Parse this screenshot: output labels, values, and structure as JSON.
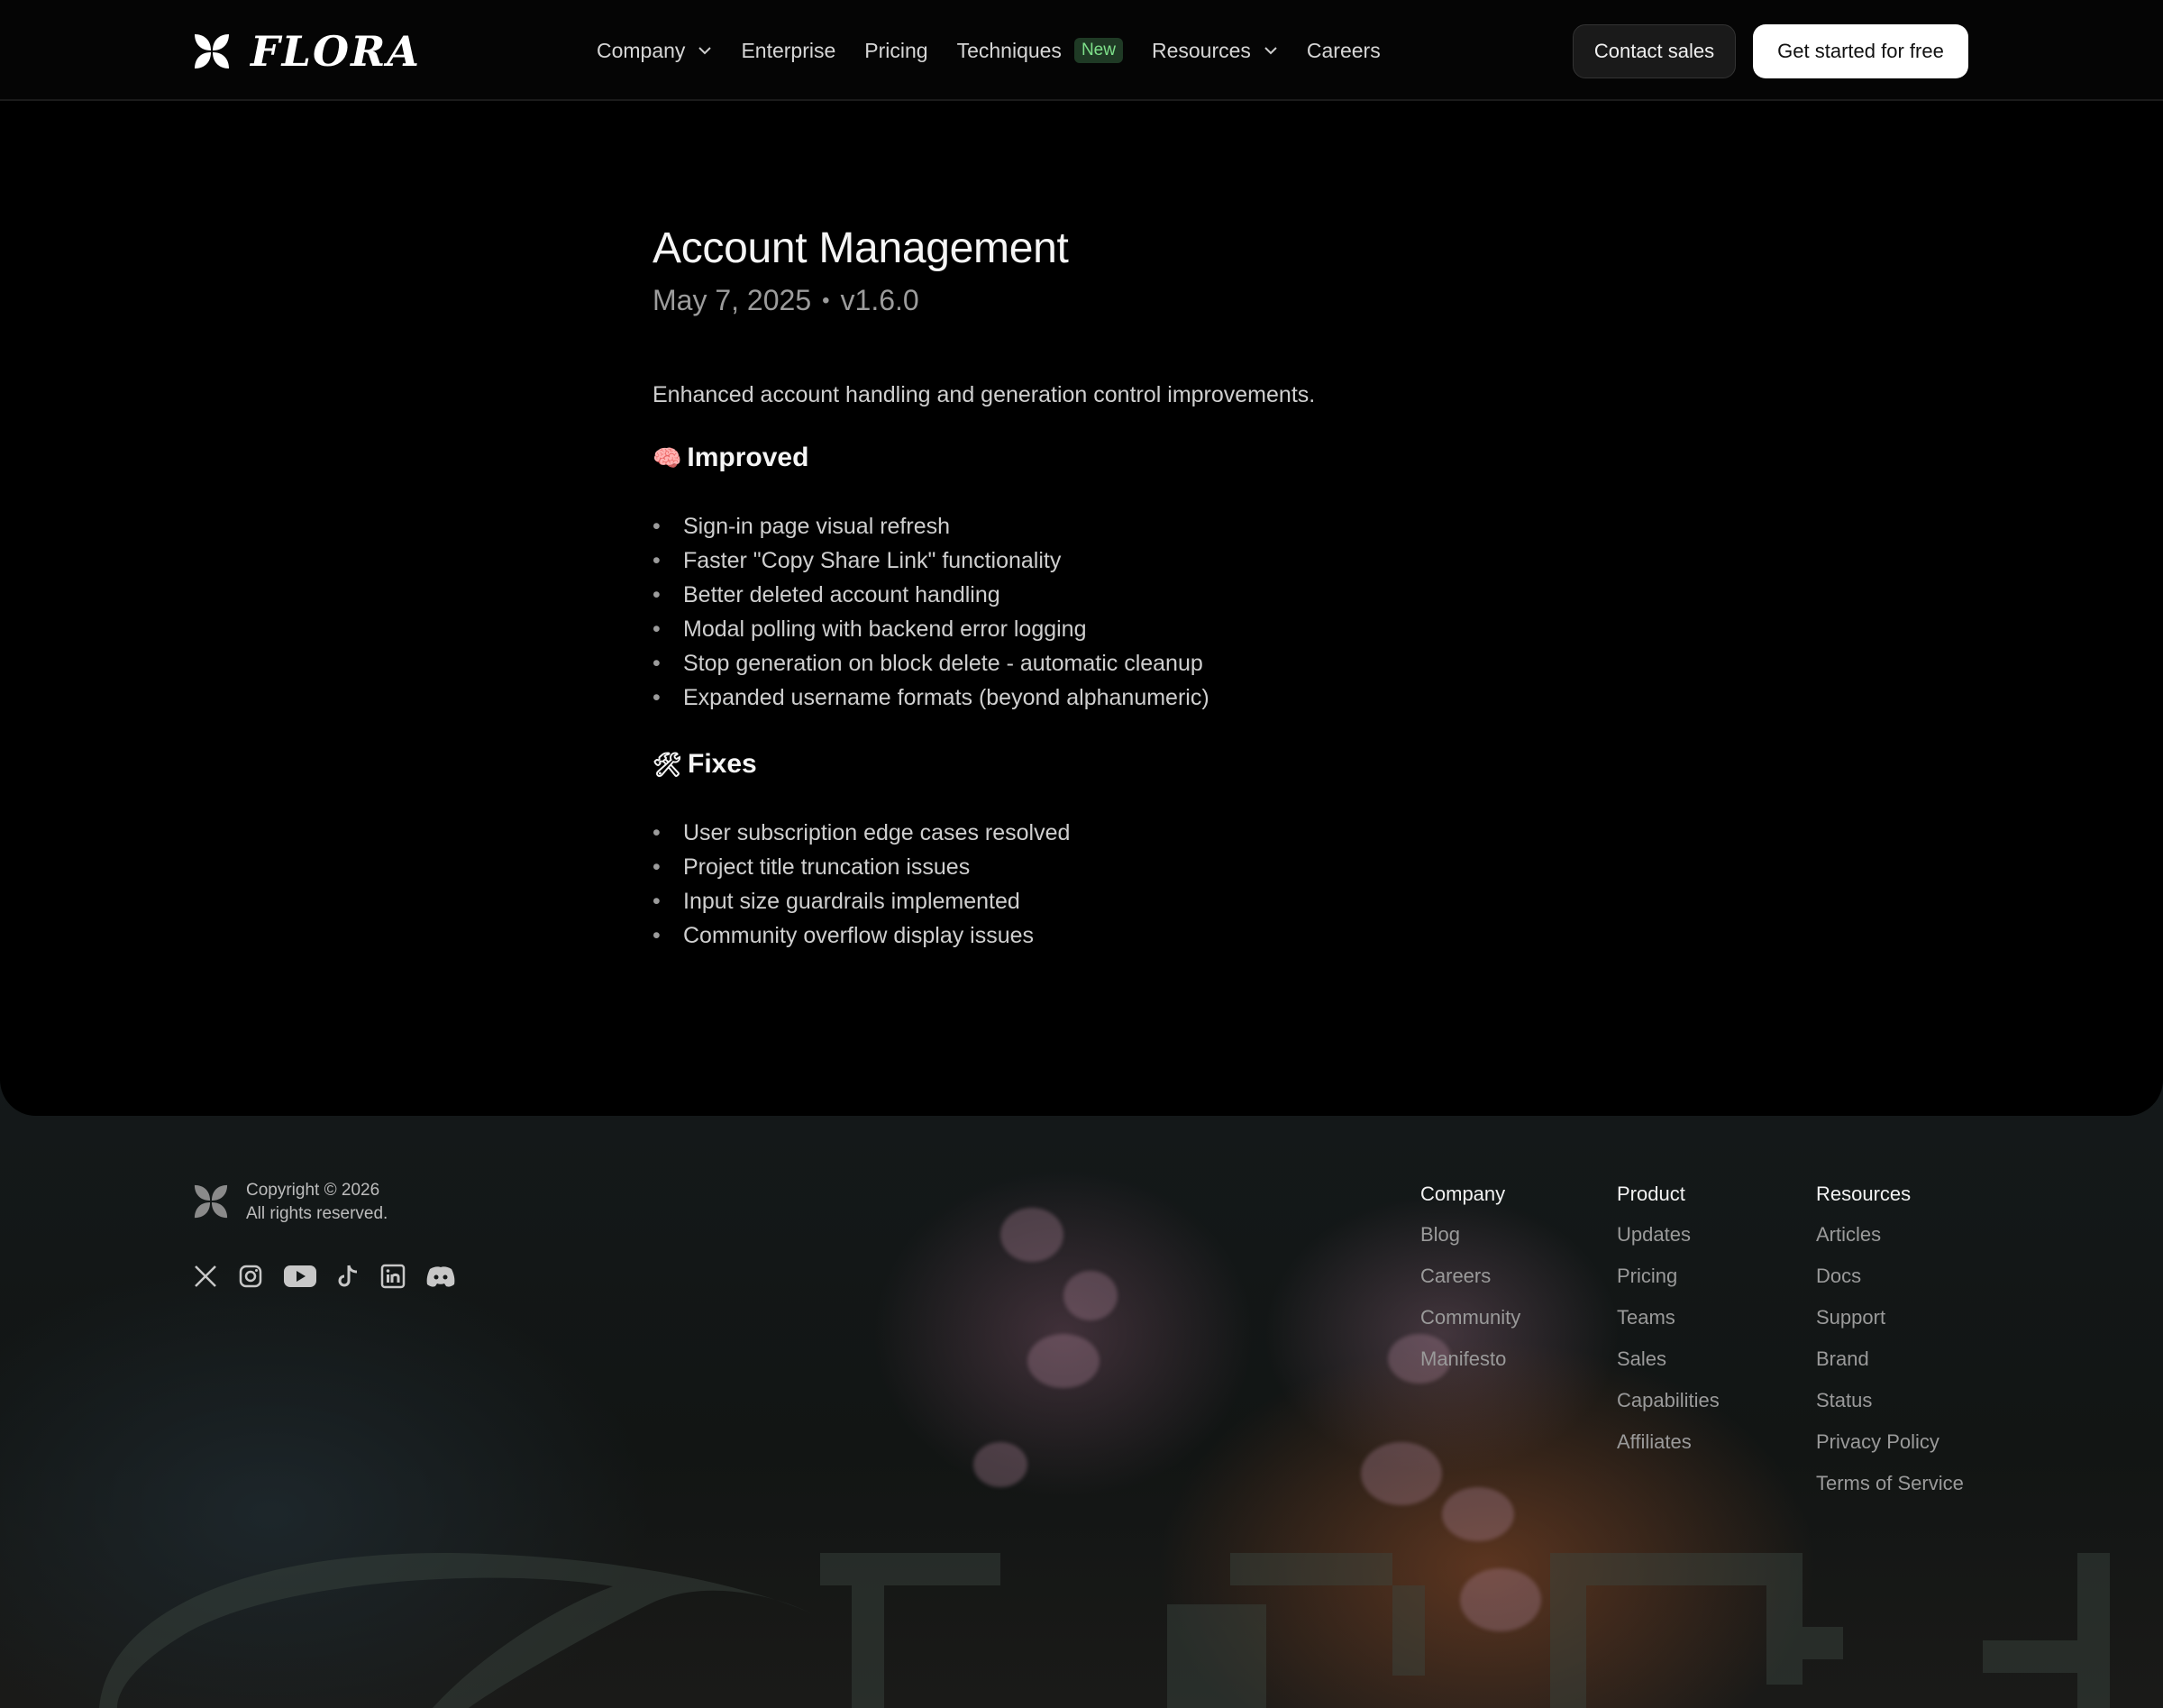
{
  "nav": {
    "brand": "FLORA",
    "items": [
      {
        "label": "Company",
        "dropdown": true
      },
      {
        "label": "Enterprise"
      },
      {
        "label": "Pricing"
      },
      {
        "label": "Techniques",
        "badge": "New"
      },
      {
        "label": "Resources",
        "dropdown": true
      },
      {
        "label": "Careers"
      }
    ],
    "contact_label": "Contact sales",
    "start_label": "Get started for free"
  },
  "article": {
    "title": "Account Management",
    "date": "May 7, 2025",
    "separator": "•",
    "version": "v1.6.0",
    "summary": "Enhanced account handling and generation control improvements.",
    "improved": {
      "emoji": "🧠",
      "heading": "Improved",
      "items": [
        "Sign-in page visual refresh",
        "Faster \"Copy Share Link\" functionality",
        "Better deleted account handling",
        "Modal polling with backend error logging",
        "Stop generation on block delete - automatic cleanup",
        "Expanded username formats (beyond alphanumeric)"
      ]
    },
    "fixes": {
      "emoji": "🛠",
      "heading": "Fixes",
      "items": [
        "User subscription edge cases resolved",
        "Project title truncation issues",
        "Input size guardrails implemented",
        "Community overflow display issues"
      ]
    }
  },
  "footer": {
    "copyright": "Copyright © 2026",
    "rights": "All rights reserved.",
    "socials": [
      "x-icon",
      "instagram-icon",
      "youtube-icon",
      "tiktok-icon",
      "linkedin-icon",
      "discord-icon"
    ],
    "columns": [
      {
        "heading": "Company",
        "links": [
          "Blog",
          "Careers",
          "Community",
          "Manifesto"
        ]
      },
      {
        "heading": "Product",
        "links": [
          "Updates",
          "Pricing",
          "Teams",
          "Sales",
          "Capabilities",
          "Affiliates"
        ]
      },
      {
        "heading": "Resources",
        "links": [
          "Articles",
          "Docs",
          "Support",
          "Brand",
          "Status",
          "Privacy Policy",
          "Terms of Service"
        ]
      }
    ]
  },
  "colors": {
    "background": "#000000",
    "badge_bg": "#1f3a25",
    "badge_text": "#7ee08a",
    "muted_text": "#9c9c9c"
  }
}
